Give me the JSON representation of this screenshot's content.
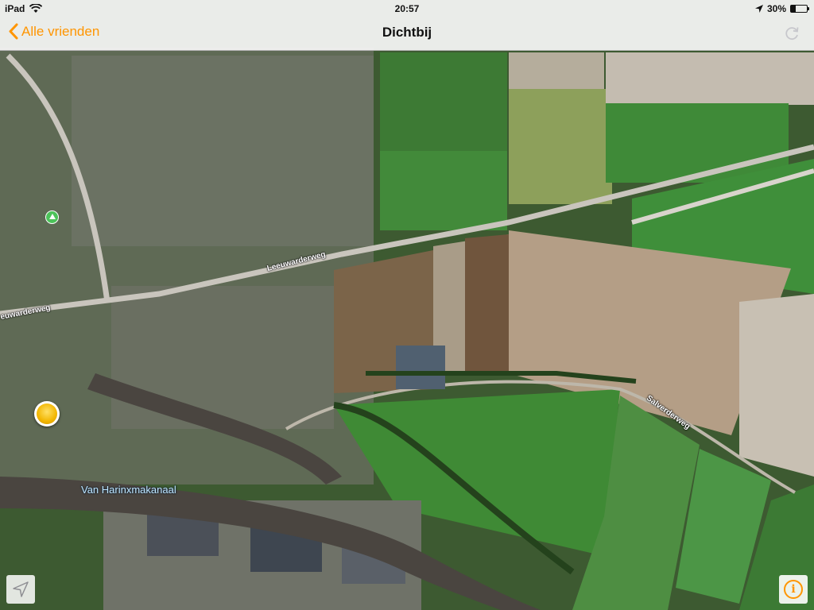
{
  "status_bar": {
    "device": "iPad",
    "time": "20:57",
    "battery_percent": "30%",
    "battery_level": 0.3
  },
  "nav": {
    "back_label": "Alle vrienden",
    "title": "Dichtbij"
  },
  "map": {
    "road_labels": [
      "Leeuwarderweg",
      "euwarderweg",
      "Salverderweg"
    ],
    "canal_label": "Van Harinxmakanaal"
  },
  "colors": {
    "accent": "#ff9500",
    "water": "#4a4540"
  },
  "icons": {
    "back": "chevron-left-icon",
    "wifi": "wifi-icon",
    "location": "location-arrow-icon",
    "refresh": "refresh-icon",
    "info": "info-icon",
    "locate": "locate-me-icon"
  }
}
